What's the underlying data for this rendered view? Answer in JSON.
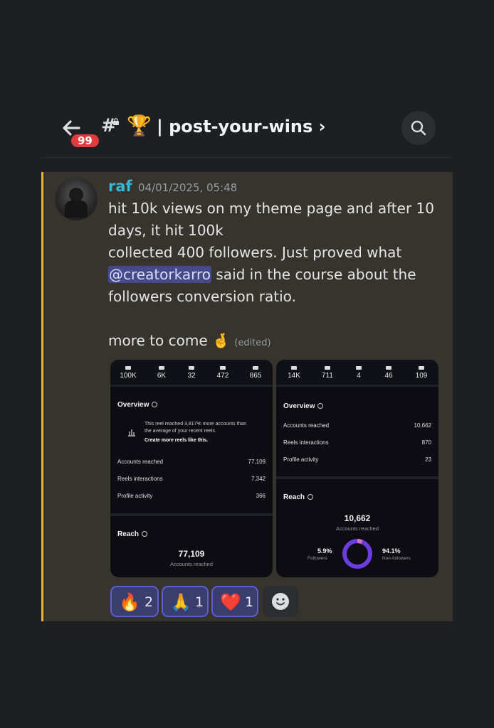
{
  "header": {
    "unread_badge": "99",
    "hash": "#",
    "channel_emoji": "🏆",
    "channel_name": "| post-your-wins ›",
    "icons": [
      "back-arrow-icon",
      "lock-icon",
      "search-icon"
    ]
  },
  "message": {
    "username": "raf",
    "timestamp": "04/01/2025, 05:48",
    "line1": "hit 10k views on my theme page and after 10 days, it hit 100k",
    "line2_before": "collected 400 followers. Just proved what ",
    "mention": "@creatorkarro",
    "line2_after": " said in the course about the followers conversion ratio.",
    "line3": "more to come 🤞",
    "edited": "(edited)",
    "accent_color": "#f0b232",
    "username_color": "#35b8d8"
  },
  "attachments": {
    "left": {
      "stats": [
        "100K",
        "6K",
        "32",
        "472",
        "865"
      ],
      "overview_title": "Overview",
      "note": "This reel reached 3,817% more accounts than the average of your recent reels.",
      "note_cta": "Create more reels like this.",
      "rows": [
        {
          "label": "Accounts reached",
          "value": "77,109"
        },
        {
          "label": "Reels interactions",
          "value": "7,342"
        },
        {
          "label": "Profile activity",
          "value": "366"
        }
      ],
      "reach_title": "Reach",
      "reach_value": "77,109",
      "reach_label": "Accounts reached"
    },
    "right": {
      "stats": [
        "14K",
        "711",
        "4",
        "46",
        "109"
      ],
      "overview_title": "Overview",
      "rows": [
        {
          "label": "Accounts reached",
          "value": "10,662"
        },
        {
          "label": "Reels interactions",
          "value": "870"
        },
        {
          "label": "Profile activity",
          "value": "23"
        }
      ],
      "reach_title": "Reach",
      "reach_value": "10,662",
      "reach_label": "Accounts reached",
      "followers_pct": "5.9%",
      "followers_label": "Followers",
      "followers_fraction": 0.059,
      "nonfollowers_pct": "94.1%",
      "nonfollowers_label": "Non-followers"
    }
  },
  "reactions": [
    {
      "emoji": "🔥",
      "count": "2"
    },
    {
      "emoji": "🙏",
      "count": "1"
    },
    {
      "emoji": "❤️",
      "count": "1"
    }
  ],
  "add_reaction_icon": "smiley-icon"
}
